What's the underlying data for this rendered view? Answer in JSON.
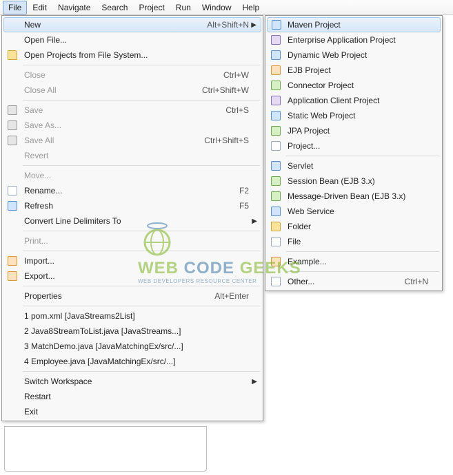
{
  "menubar": [
    "File",
    "Edit",
    "Navigate",
    "Search",
    "Project",
    "Run",
    "Window",
    "Help"
  ],
  "file_menu": [
    {
      "label": "New",
      "shortcut": "Alt+Shift+N",
      "arrow": true,
      "highlight": true,
      "icon": null,
      "name": "menu-new"
    },
    {
      "label": "Open File...",
      "icon": null,
      "name": "menu-open-file"
    },
    {
      "label": "Open Projects from File System...",
      "icon": "folder",
      "name": "menu-open-projects"
    },
    {
      "sep": true
    },
    {
      "label": "Close",
      "shortcut": "Ctrl+W",
      "disabled": true,
      "name": "menu-close"
    },
    {
      "label": "Close All",
      "shortcut": "Ctrl+Shift+W",
      "disabled": true,
      "name": "menu-close-all"
    },
    {
      "sep": true
    },
    {
      "label": "Save",
      "shortcut": "Ctrl+S",
      "disabled": true,
      "icon": "gray",
      "name": "menu-save"
    },
    {
      "label": "Save As...",
      "disabled": true,
      "icon": "gray",
      "name": "menu-save-as"
    },
    {
      "label": "Save All",
      "shortcut": "Ctrl+Shift+S",
      "disabled": true,
      "icon": "gray",
      "name": "menu-save-all"
    },
    {
      "label": "Revert",
      "disabled": true,
      "name": "menu-revert"
    },
    {
      "sep": true
    },
    {
      "label": "Move...",
      "disabled": true,
      "name": "menu-move"
    },
    {
      "label": "Rename...",
      "shortcut": "F2",
      "icon": "doc",
      "name": "menu-rename"
    },
    {
      "label": "Refresh",
      "shortcut": "F5",
      "icon": "blue",
      "name": "menu-refresh"
    },
    {
      "label": "Convert Line Delimiters To",
      "arrow": true,
      "name": "menu-convert-delim"
    },
    {
      "sep": true
    },
    {
      "label": "Print...",
      "disabled": true,
      "name": "menu-print"
    },
    {
      "sep": true
    },
    {
      "label": "Import...",
      "icon": "orange",
      "name": "menu-import"
    },
    {
      "label": "Export...",
      "icon": "orange",
      "name": "menu-export"
    },
    {
      "sep": true
    },
    {
      "label": "Properties",
      "shortcut": "Alt+Enter",
      "name": "menu-properties"
    },
    {
      "sep": true
    },
    {
      "label": "1 pom.xml  [JavaStreams2List]",
      "name": "menu-recent-1"
    },
    {
      "label": "2 Java8StreamToList.java  [JavaStreams...]",
      "name": "menu-recent-2"
    },
    {
      "label": "3 MatchDemo.java  [JavaMatchingEx/src/...]",
      "name": "menu-recent-3"
    },
    {
      "label": "4 Employee.java  [JavaMatchingEx/src/...]",
      "name": "menu-recent-4"
    },
    {
      "sep": true
    },
    {
      "label": "Switch Workspace",
      "arrow": true,
      "name": "menu-switch-ws"
    },
    {
      "label": "Restart",
      "name": "menu-restart"
    },
    {
      "label": "Exit",
      "name": "menu-exit"
    }
  ],
  "new_menu": [
    {
      "label": "Maven Project",
      "icon": "blue",
      "highlight": true,
      "name": "new-maven"
    },
    {
      "label": "Enterprise Application Project",
      "icon": "purple",
      "name": "new-ear"
    },
    {
      "label": "Dynamic Web Project",
      "icon": "blue",
      "name": "new-dynamic-web"
    },
    {
      "label": "EJB Project",
      "icon": "orange",
      "name": "new-ejb"
    },
    {
      "label": "Connector Project",
      "icon": "green",
      "name": "new-connector"
    },
    {
      "label": "Application Client Project",
      "icon": "purple",
      "name": "new-app-client"
    },
    {
      "label": "Static Web Project",
      "icon": "blue",
      "name": "new-static-web"
    },
    {
      "label": "JPA Project",
      "icon": "green",
      "name": "new-jpa"
    },
    {
      "label": "Project...",
      "icon": "doc",
      "name": "new-project"
    },
    {
      "sep": true
    },
    {
      "label": "Servlet",
      "icon": "blue",
      "name": "new-servlet"
    },
    {
      "label": "Session Bean (EJB 3.x)",
      "icon": "green",
      "name": "new-session-bean"
    },
    {
      "label": "Message-Driven Bean (EJB 3.x)",
      "icon": "green",
      "name": "new-mdb"
    },
    {
      "label": "Web Service",
      "icon": "blue",
      "name": "new-webservice"
    },
    {
      "label": "Folder",
      "icon": "folder",
      "name": "new-folder"
    },
    {
      "label": "File",
      "icon": "doc",
      "name": "new-file"
    },
    {
      "sep": true
    },
    {
      "label": "Example...",
      "icon": "orange",
      "name": "new-example"
    },
    {
      "sep": true
    },
    {
      "label": "Other...",
      "shortcut": "Ctrl+N",
      "icon": "doc",
      "name": "new-other"
    }
  ],
  "watermark": {
    "title_web": "WEB",
    "title_code": "CODE",
    "title_geeks": "GEEKS",
    "subtitle": "WEB DEVELOPERS RESOURCE CENTER"
  }
}
